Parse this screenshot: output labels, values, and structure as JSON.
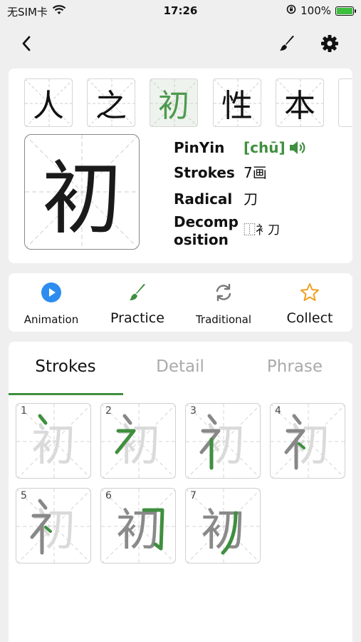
{
  "status_bar": {
    "carrier": "无SIM卡",
    "time": "17:26",
    "battery": "100%"
  },
  "nav": {
    "back_icon": "chevron-left-icon",
    "brush_icon": "brush-icon",
    "settings_icon": "gear-icon"
  },
  "characters": [
    {
      "char": "人",
      "selected": false
    },
    {
      "char": "之",
      "selected": false
    },
    {
      "char": "初",
      "selected": true
    },
    {
      "char": "性",
      "selected": false
    },
    {
      "char": "本",
      "selected": false
    }
  ],
  "detail": {
    "big_char": "初",
    "pinyin_label": "PinYin",
    "pinyin_value": "[chū]",
    "strokes_label": "Strokes",
    "strokes_value": "7画",
    "radical_label": "Radical",
    "radical_value": "刀",
    "decomp_label_1": "Decomp",
    "decomp_label_2": "osition",
    "decomp_value": "⿰衤刀"
  },
  "actions": [
    {
      "label": "Animation",
      "icon": "play-circle-icon"
    },
    {
      "label": "Practice",
      "icon": "brush-icon"
    },
    {
      "label": "Traditional",
      "icon": "refresh-icon"
    },
    {
      "label": "Collect",
      "icon": "star-icon"
    }
  ],
  "tabs": {
    "strokes": "Strokes",
    "detail": "Detail",
    "phrase": "Phrase"
  },
  "stroke_steps": [
    {
      "number": "1",
      "char": "初"
    },
    {
      "number": "2",
      "char": "初"
    },
    {
      "number": "3",
      "char": "初"
    },
    {
      "number": "4",
      "char": "初"
    },
    {
      "number": "5",
      "char": "初"
    },
    {
      "number": "6",
      "char": "初"
    },
    {
      "number": "7",
      "char": "初"
    }
  ],
  "colors": {
    "accent_green": "#3f8f3f",
    "blue": "#2d8cf0",
    "star": "#f0a020"
  }
}
